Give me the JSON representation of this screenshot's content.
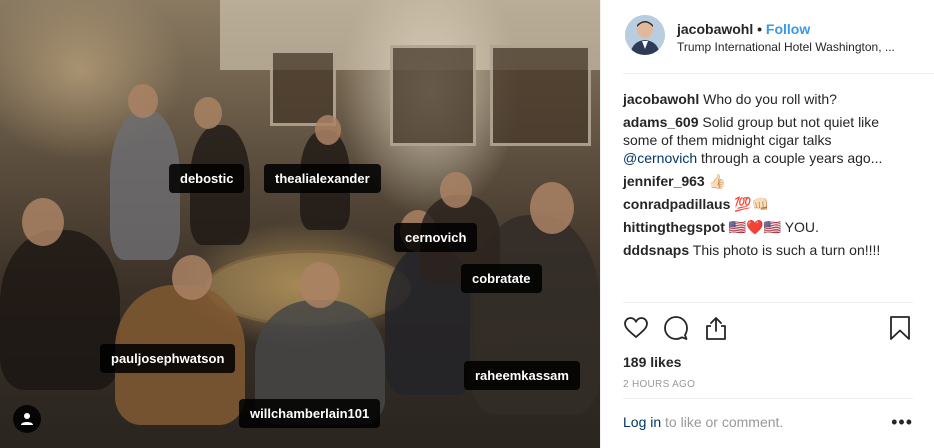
{
  "photo": {
    "tags": [
      {
        "name": "debostic"
      },
      {
        "name": "thealialexander"
      },
      {
        "name": "cernovich"
      },
      {
        "name": "cobratate"
      },
      {
        "name": "pauljosephwatson"
      },
      {
        "name": "raheemkassam"
      },
      {
        "name": "willchamberlain101"
      }
    ],
    "user_badge_icon": "person-icon"
  },
  "header": {
    "username": "jacobawohl",
    "separator": "•",
    "follow_label": "Follow",
    "location": "Trump International Hotel Washington, ..."
  },
  "comments": [
    {
      "user": "jacobawohl",
      "text": "Who do you roll with?"
    },
    {
      "user": "adams_609",
      "text": "Solid group but not quiet like some of them midnight cigar talks",
      "mention": "@cernovich",
      "text_after": "through a couple years ago..."
    },
    {
      "user": "jennifer_963",
      "text": "👍🏻"
    },
    {
      "user": "conradpadillaus",
      "text": "💯👊🏻"
    },
    {
      "user": "hittingthegspot",
      "text": "🇺🇸❤️🇺🇸 YOU."
    },
    {
      "user": "dddsnaps",
      "text": "This photo is such a turn on!!!!"
    }
  ],
  "actions": {
    "icons": [
      "heart-icon",
      "comment-icon",
      "share-icon",
      "bookmark-icon"
    ],
    "likes": "189 likes",
    "timestamp": "2 HOURS AGO"
  },
  "footer": {
    "login_link": "Log in",
    "login_text": "to like or comment.",
    "more_label": "•••"
  },
  "colors": {
    "accent": "#3897f0",
    "mention": "#003569",
    "muted": "#999999",
    "text": "#262626"
  }
}
